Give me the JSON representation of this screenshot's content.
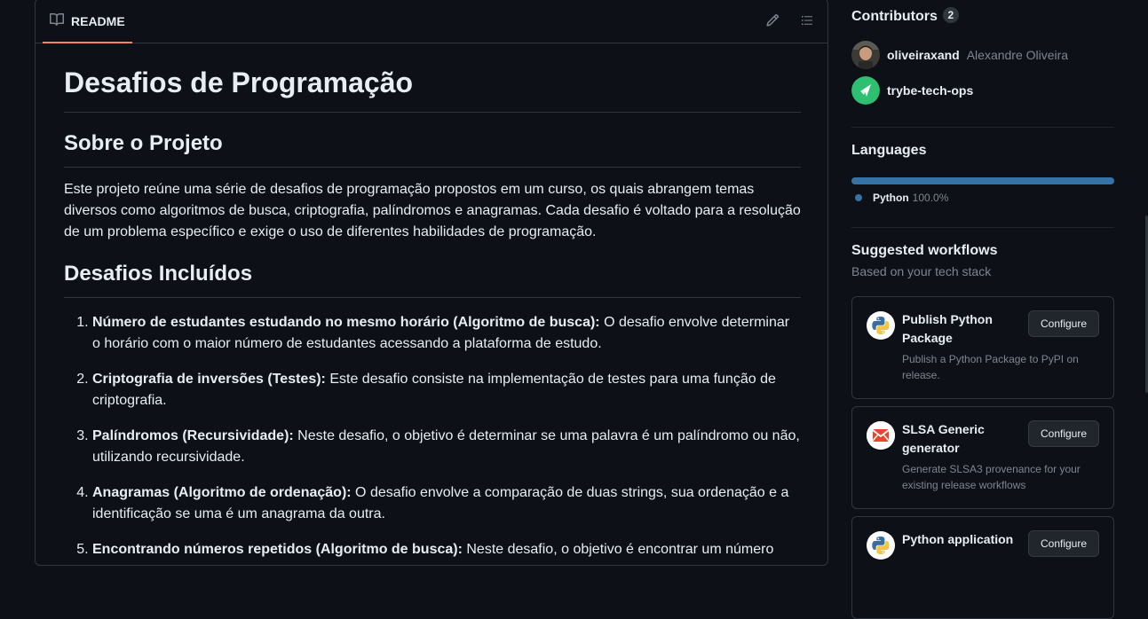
{
  "readme": {
    "tab_label": "README",
    "title": "Desafios de Programação",
    "sections": [
      {
        "heading": "Sobre o Projeto",
        "paragraph": "Este projeto reúne uma série de desafios de programação propostos em um curso, os quais abrangem temas diversos como algoritmos de busca, criptografia, palíndromos e anagramas. Cada desafio é voltado para a resolução de um problema específico e exige o uso de diferentes habilidades de programação."
      },
      {
        "heading": "Desafios Incluídos"
      }
    ],
    "items": [
      {
        "bold": "Número de estudantes estudando no mesmo horário (Algoritmo de busca):",
        "text": " O desafio envolve determinar o horário com o maior número de estudantes acessando a plataforma de estudo."
      },
      {
        "bold": "Criptografia de inversões (Testes):",
        "text": " Este desafio consiste na implementação de testes para uma função de criptografia."
      },
      {
        "bold": "Palíndromos (Recursividade):",
        "text": " Neste desafio, o objetivo é determinar se uma palavra é um palíndromo ou não, utilizando recursividade."
      },
      {
        "bold": "Anagramas (Algoritmo de ordenação):",
        "text": " O desafio envolve a comparação de duas strings, sua ordenação e a identificação se uma é um anagrama da outra."
      },
      {
        "bold": "Encontrando números repetidos (Algoritmo de busca):",
        "text": " Neste desafio, o objetivo é encontrar um número"
      }
    ]
  },
  "sidebar": {
    "contributors": {
      "title": "Contributors",
      "count": "2",
      "people": [
        {
          "login": "oliveiraxand",
          "name": "Alexandre Oliveira"
        },
        {
          "login": "trybe-tech-ops",
          "name": ""
        }
      ]
    },
    "languages": {
      "title": "Languages",
      "items": [
        {
          "name": "Python",
          "percent": "100.0%",
          "fraction": 1.0,
          "color": "#3572a5"
        }
      ]
    },
    "workflows": {
      "title": "Suggested workflows",
      "subtitle": "Based on your tech stack",
      "button_label": "Configure",
      "items": [
        {
          "title": "Publish Python Package",
          "description": "Publish a Python Package to PyPI on release.",
          "icon": "python-icon"
        },
        {
          "title": "SLSA Generic generator",
          "description": "Generate SLSA3 provenance for your existing release workflows",
          "icon": "slsa-icon"
        },
        {
          "title": "Python application",
          "description": "",
          "icon": "python-icon"
        }
      ]
    }
  },
  "colors": {
    "accent_tab": "#f78166",
    "python": "#3572a5",
    "background": "#0d1117"
  }
}
